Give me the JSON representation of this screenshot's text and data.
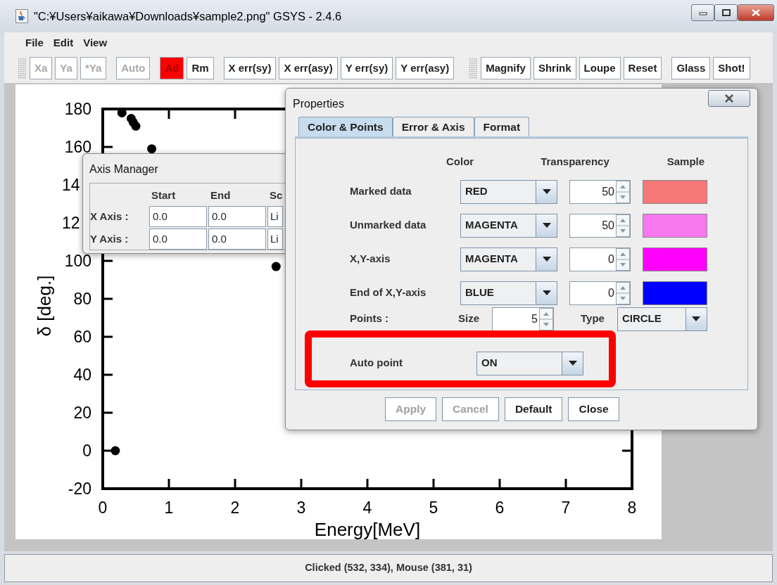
{
  "window": {
    "title": "\"C:¥Users¥aikawa¥Downloads¥sample2.png\" GSYS - 2.4.6"
  },
  "menu": [
    "File",
    "Edit",
    "View"
  ],
  "toolbar": [
    {
      "grip": true,
      "buttons": [
        {
          "label": "Xa",
          "disabled": true,
          "active": false
        },
        {
          "label": "Ya",
          "disabled": true,
          "active": false
        },
        {
          "label": "*Ya",
          "disabled": true,
          "active": false
        }
      ]
    },
    {
      "grip": false,
      "buttons": [
        {
          "label": "Auto",
          "disabled": true,
          "active": false
        }
      ]
    },
    {
      "grip": false,
      "buttons": [
        {
          "label": "Ad",
          "disabled": false,
          "active": true
        },
        {
          "label": "Rm",
          "disabled": false,
          "active": false
        }
      ]
    },
    {
      "grip": false,
      "buttons": [
        {
          "label": "X err(sy)",
          "disabled": false,
          "active": false
        },
        {
          "label": "X err(asy)",
          "disabled": false,
          "active": false
        },
        {
          "label": "Y err(sy)",
          "disabled": false,
          "active": false
        },
        {
          "label": "Y err(asy)",
          "disabled": false,
          "active": false
        }
      ]
    },
    {
      "grip": true,
      "buttons": [
        {
          "label": "Magnify",
          "disabled": false,
          "active": false
        },
        {
          "label": "Shrink",
          "disabled": false,
          "active": false
        },
        {
          "label": "Loupe",
          "disabled": false,
          "active": false
        },
        {
          "label": "Reset",
          "disabled": false,
          "active": false
        }
      ]
    },
    {
      "grip": false,
      "buttons": [
        {
          "label": "Glass",
          "disabled": false,
          "active": false
        },
        {
          "label": "Shot!",
          "disabled": false,
          "active": false
        }
      ]
    }
  ],
  "plot": {
    "chart_data": {
      "type": "scatter",
      "xlabel": "Energy[MeV]",
      "ylabel": "δ [deg.]",
      "xlim": [
        0,
        8
      ],
      "ylim": [
        -20,
        180
      ],
      "xticks": [
        0,
        1,
        2,
        3,
        4,
        5,
        6,
        7,
        8
      ],
      "yticks": [
        -20,
        0,
        20,
        40,
        60,
        80,
        100,
        160,
        180
      ],
      "x": [
        0.19,
        0.29,
        0.43,
        0.46,
        0.5,
        0.74,
        2.62
      ],
      "series": [
        {
          "color": "#000000",
          "values": [
            0,
            178,
            175,
            173,
            171,
            159,
            97
          ]
        }
      ]
    },
    "partial_tick_labels": [
      "14",
      "12"
    ]
  },
  "axis_manager": {
    "title": "Axis Manager",
    "columns": [
      "Start",
      "End",
      "Sc"
    ],
    "rows": [
      {
        "label": "X Axis :",
        "start": "0.0",
        "end": "0.0",
        "scale": "Li"
      },
      {
        "label": "Y Axis :",
        "start": "0.0",
        "end": "0.0",
        "scale": "Li"
      }
    ]
  },
  "properties": {
    "title": "Properties",
    "tabs": [
      {
        "label": "Color & Points",
        "selected": true
      },
      {
        "label": "Error & Axis",
        "selected": false
      },
      {
        "label": "Format",
        "selected": false
      }
    ],
    "headers": [
      "Color",
      "Transparency",
      "Sample"
    ],
    "rows": [
      {
        "label": "Marked data",
        "color_name": "RED",
        "transparency": "50",
        "color": "#f87878"
      },
      {
        "label": "Unmarked data",
        "color_name": "MAGENTA",
        "transparency": "50",
        "color": "#f878f0"
      },
      {
        "label": "X,Y-axis",
        "color_name": "MAGENTA",
        "transparency": "0",
        "color": "#ff00ff"
      },
      {
        "label": "End of X,Y-axis",
        "color_name": "BLUE",
        "transparency": "0",
        "color": "#0000ff"
      }
    ],
    "points": {
      "label": "Points :",
      "size_label": "Size",
      "size": "5",
      "type_label": "Type",
      "type": "CIRCLE"
    },
    "auto_point": {
      "label": "Auto point",
      "value": "ON",
      "highlighted": true
    },
    "buttons": [
      {
        "label": "Apply",
        "disabled": true
      },
      {
        "label": "Cancel",
        "disabled": true
      },
      {
        "label": "Default",
        "disabled": false
      },
      {
        "label": "Close",
        "disabled": false
      }
    ]
  },
  "status_bar": "Clicked (532, 334), Mouse (381, 31)"
}
